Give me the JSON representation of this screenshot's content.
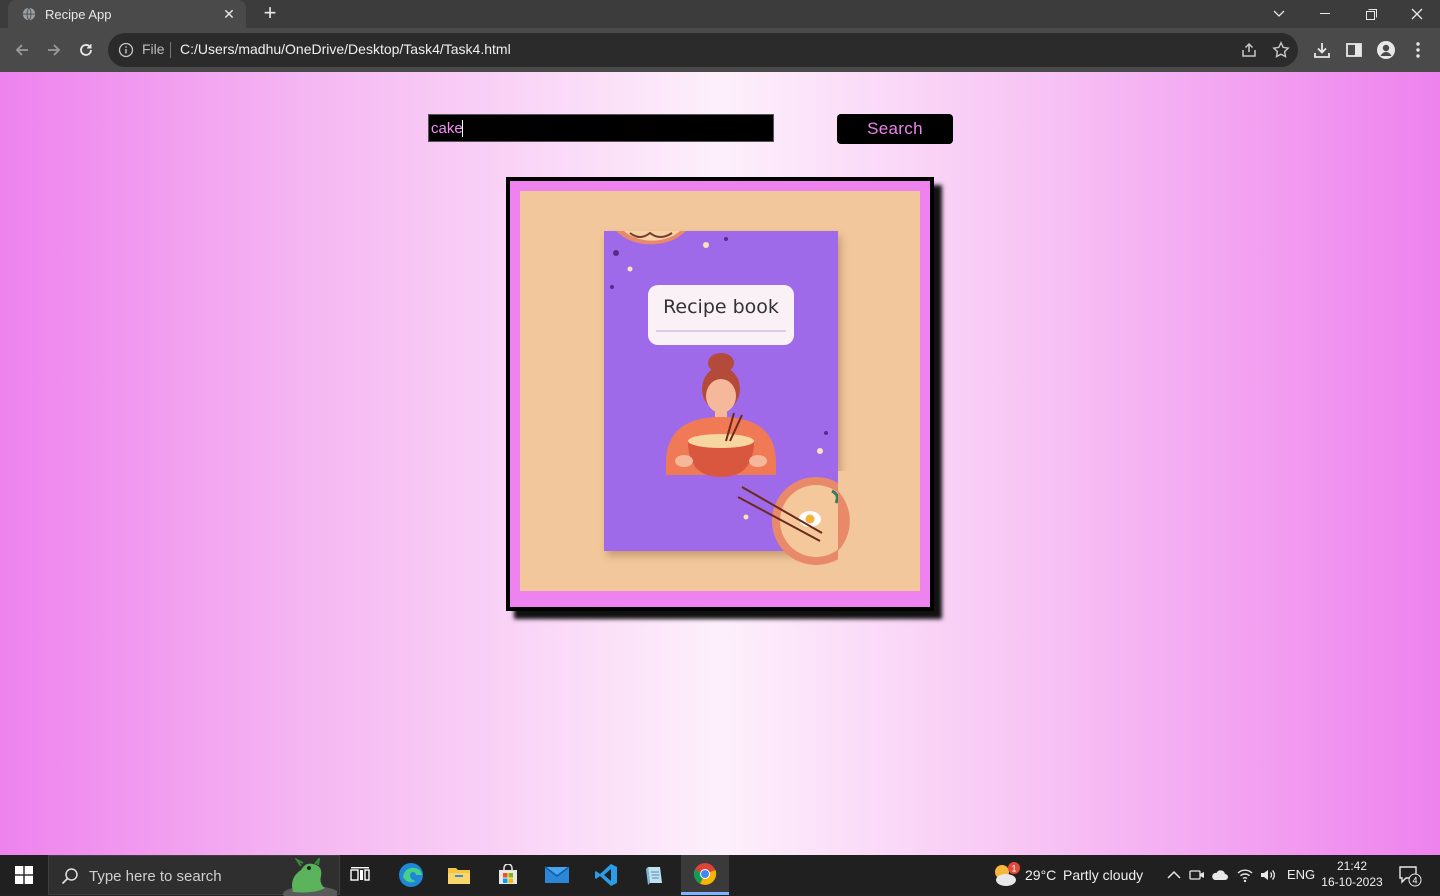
{
  "browser": {
    "tab_title": "Recipe App",
    "omnibox_label": "File",
    "url": "C:/Users/madhu/OneDrive/Desktop/Task4/Task4.html"
  },
  "page": {
    "search_value": "cake",
    "search_button": "Search",
    "card_title": "Recipe book",
    "colors": {
      "accent": "#ee82ee",
      "card_bg": "#f2c79b",
      "book_cover": "#9f6aea"
    }
  },
  "taskbar": {
    "search_placeholder": "Type here to search",
    "weather_temp": "29°C",
    "weather_desc": "Partly cloudy",
    "weather_badge": "1",
    "language": "ENG",
    "time": "21:42",
    "date": "16-10-2023",
    "notification_count": "4"
  }
}
